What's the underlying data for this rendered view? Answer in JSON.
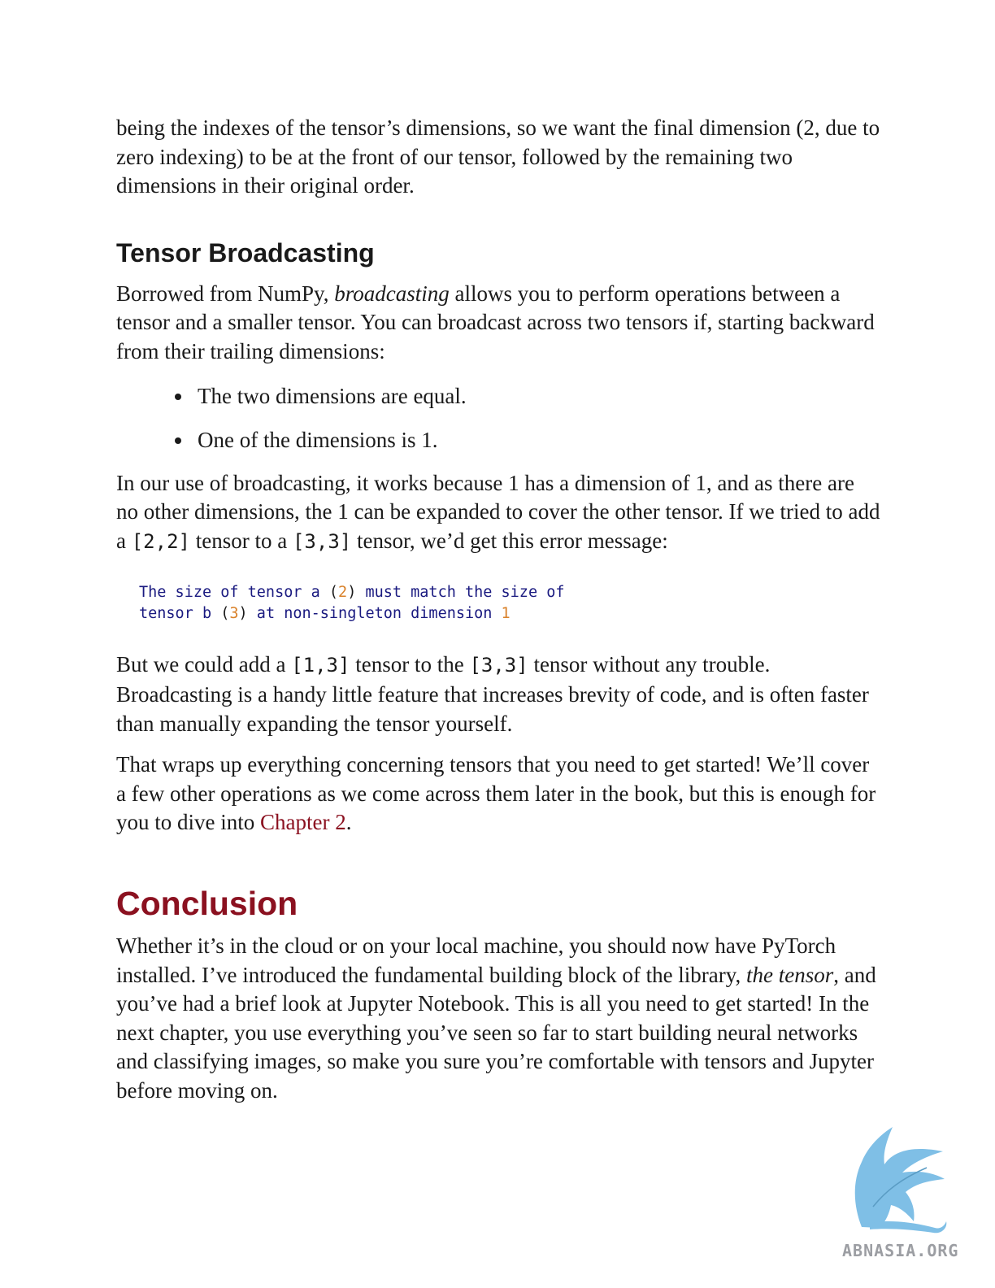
{
  "para_intro": "being the indexes of the tensor’s dimensions, so we want the final dimension (2, due to zero indexing) to be at the front of our tensor, followed by the remaining two dimensions in their original order.",
  "heading_broadcasting": "Tensor Broadcasting",
  "para_broadcast": {
    "before": "Borrowed from NumPy, ",
    "em": "broadcasting",
    "after": " allows you to perform operations between a tensor and a smaller tensor. You can broadcast across two tensors if, starting backward from their trailing dimensions:"
  },
  "bullets": [
    "The two dimensions are equal.",
    "One of the dimensions is 1."
  ],
  "para_use": {
    "t1": "In our use of broadcasting, it works because 1 has a dimension of 1, and as there are no other dimensions, the 1 can be expanded to cover the other tensor. If we tried to add a ",
    "c1": "[2,2]",
    "t2": " tensor to a ",
    "c2": "[3,3]",
    "t3": " tensor, we’d get this error message:"
  },
  "code": {
    "l1a": "The size of tensor a ",
    "l1p1": "(",
    "l1n": "2",
    "l1p2": ")",
    "l1b": " must match the size of",
    "l2a": "tensor b ",
    "l2p1": "(",
    "l2n": "3",
    "l2p2": ")",
    "l2b": " at non-singleton dimension ",
    "l2n2": "1"
  },
  "para_but": {
    "t1": "But we could add a ",
    "c1": "[1,3]",
    "t2": " tensor to the ",
    "c2": "[3,3]",
    "t3": " tensor without any trouble. Broadcasting is a handy little feature that increases brevity of code, and is often faster than manually expanding the tensor yourself."
  },
  "para_wrap": {
    "t1": "That wraps up everything concerning tensors that you need to get started! We’ll cover a few other operations as we come across them later in the book, but this is enough for you to dive into ",
    "link": "Chapter 2",
    "t2": "."
  },
  "heading_conclusion": "Conclusion",
  "para_conclusion": {
    "t1": "Whether it’s in the cloud or on your local machine, you should now have PyTorch installed. I’ve introduced the fundamental building block of the library, ",
    "em": "the tensor",
    "t2": ", and you’ve had a brief look at Jupyter Notebook. This is all you need to get started! In the next chapter, you use everything you’ve seen so far to start building neural networks and classifying images, so make you sure you’re comfortable with tensors and Jupyter before moving on."
  },
  "watermark": "ABNASIA.ORG",
  "colors": {
    "accent": "#8b1120",
    "code_text": "#1a1a80",
    "code_number": "#d9822b",
    "logo": "#7fbfe6"
  }
}
